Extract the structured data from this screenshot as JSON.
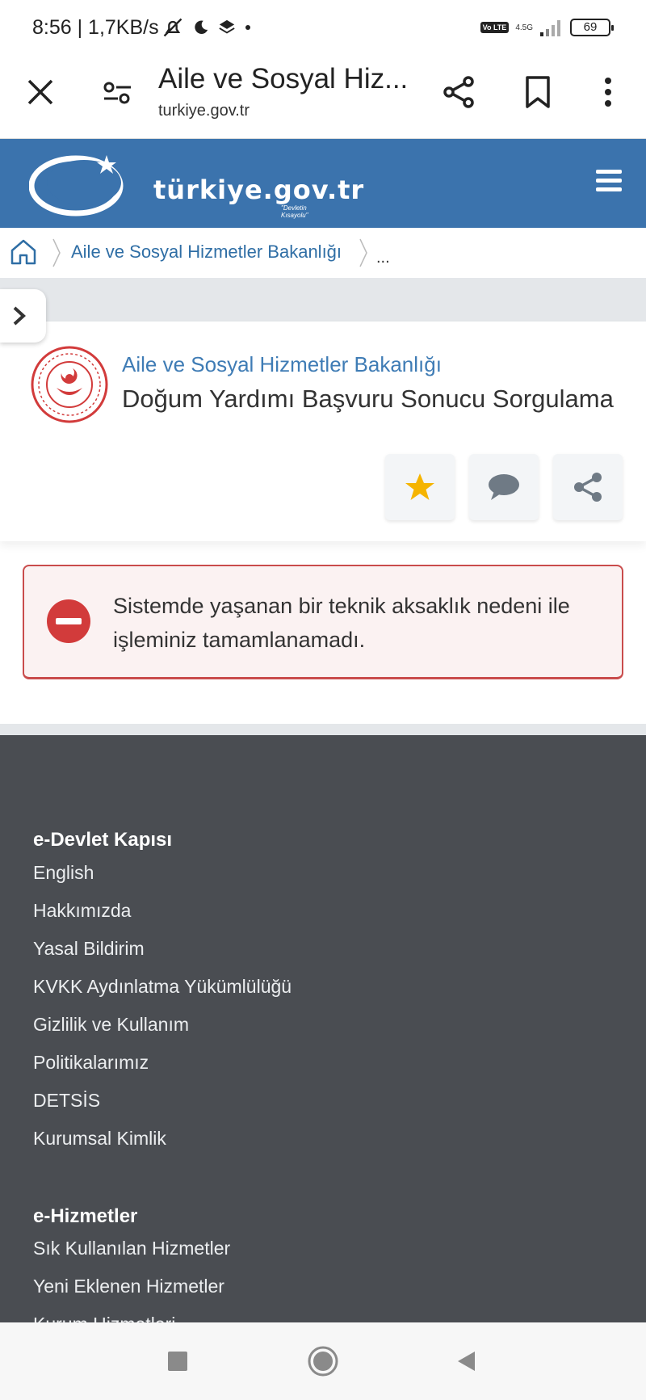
{
  "status_bar": {
    "time_speed": "8:56 | 1,7KB/s",
    "volte": "Vo LTE",
    "network": "4.5G",
    "battery": "69"
  },
  "browser": {
    "title": "Aile ve Sosyal Hiz...",
    "url": "turkiye.gov.tr"
  },
  "site_header": {
    "logo_text": "türkiye.gov.tr",
    "logo_tagline": "\"Devletin Kısayolu\""
  },
  "breadcrumb": {
    "items": [
      "Aile ve Sosyal Hizmetler Bakanlığı"
    ],
    "more": "..."
  },
  "service": {
    "ministry": "Aile ve Sosyal Hizmetler Bakanlığı",
    "title": "Doğum Yardımı Başvuru Sonucu Sorgulama"
  },
  "alert": {
    "message": "Sistemde yaşanan bir teknik aksaklık nedeni ile işleminiz tamamlanamadı."
  },
  "footer": {
    "sections": [
      {
        "heading": "e-Devlet Kapısı",
        "links": [
          "English",
          "Hakkımızda",
          "Yasal Bildirim",
          "KVKK Aydınlatma Yükümlülüğü",
          "Gizlilik ve Kullanım",
          "Politikalarımız",
          "DETSİS",
          "Kurumsal Kimlik"
        ]
      },
      {
        "heading": "e-Hizmetler",
        "links": [
          "Sık Kullanılan Hizmetler",
          "Yeni Eklenen Hizmetler",
          "Kurum Hizmetleri"
        ]
      }
    ]
  },
  "colors": {
    "header_blue": "#3b73ad",
    "link_blue": "#2f6ea5",
    "footer_bg": "#4a4d52",
    "alert_red": "#c94c4c",
    "star_gold": "#f5b400"
  }
}
